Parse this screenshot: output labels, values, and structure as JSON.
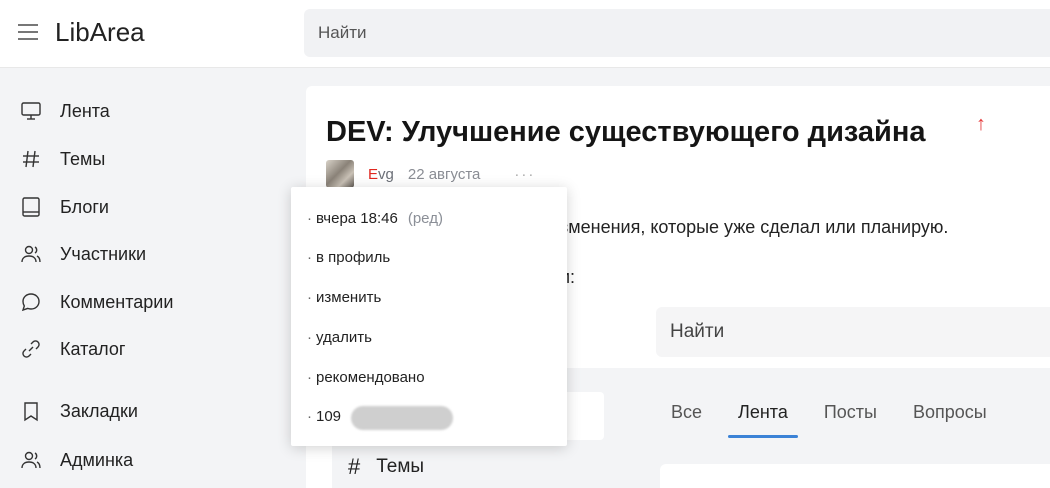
{
  "header": {
    "logo": "LibArea",
    "search_placeholder": "Найти"
  },
  "sidebar": {
    "items": [
      {
        "label": "Лента",
        "icon": "monitor-icon"
      },
      {
        "label": "Темы",
        "icon": "hash-icon"
      },
      {
        "label": "Блоги",
        "icon": "book-icon"
      },
      {
        "label": "Участники",
        "icon": "users-icon"
      },
      {
        "label": "Комментарии",
        "icon": "comment-icon"
      },
      {
        "label": "Каталог",
        "icon": "link-icon"
      },
      {
        "label": "Закладки",
        "icon": "bookmark-icon"
      },
      {
        "label": "Админка",
        "icon": "users-icon"
      }
    ]
  },
  "post": {
    "title": "DEV: Улучшение существующего дизайна",
    "vote_icon": "arrow-up-icon",
    "author_first": "E",
    "author_rest": "vg",
    "date": "22 августа",
    "more": "···",
    "text_line1": "зменения, которые уже сделал или планирую.",
    "text_line2": "и:"
  },
  "embedded": {
    "search_label": "Найти",
    "tabs": [
      {
        "label": "Все",
        "active": false
      },
      {
        "label": "Лента",
        "active": true
      },
      {
        "label": "Посты",
        "active": false
      },
      {
        "label": "Вопросы",
        "active": false
      }
    ],
    "themes_label": "Темы"
  },
  "dropdown": {
    "items": [
      {
        "label": "вчера 18:46",
        "extra": "(ред)"
      },
      {
        "label": "в профиль"
      },
      {
        "label": "изменить"
      },
      {
        "label": "удалить"
      },
      {
        "label": "рекомендовано"
      },
      {
        "label": "109"
      }
    ],
    "bullet": "·"
  },
  "colors": {
    "accent_red": "#e0271f",
    "tab_underline": "#3b82d6",
    "background": "#f3f4f6"
  }
}
